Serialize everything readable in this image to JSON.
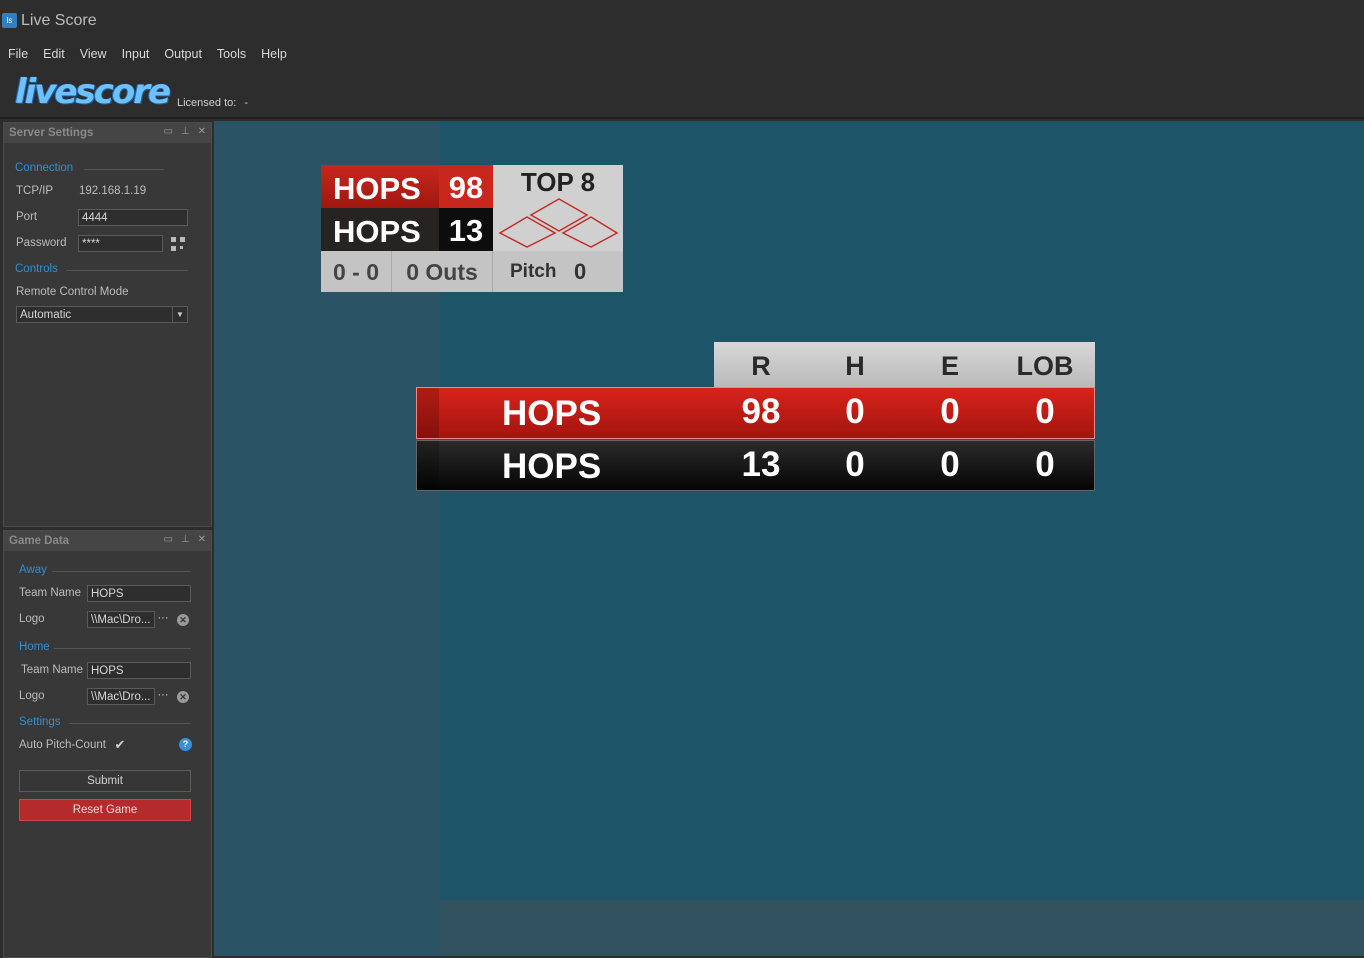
{
  "window": {
    "title": "Live Score",
    "icon": "live-score-app-icon"
  },
  "menu": [
    "File",
    "Edit",
    "View",
    "Input",
    "Output",
    "Tools",
    "Help"
  ],
  "header": {
    "logo_text": "livescore",
    "licensed_label": "Licensed to:",
    "licensed_value": "-"
  },
  "server_settings": {
    "title": "Server Settings",
    "connection_section": "Connection",
    "tcp_label": "TCP/IP",
    "tcp_value": "192.168.1.19",
    "port_label": "Port",
    "port_value": "4444",
    "password_label": "Password",
    "password_value": "****",
    "controls_section": "Controls",
    "remote_mode_label": "Remote Control Mode",
    "remote_mode_value": "Automatic"
  },
  "game_data": {
    "title": "Game Data",
    "away_section": "Away",
    "away_team_label": "Team Name",
    "away_team_value": "HOPS",
    "away_logo_label": "Logo",
    "away_logo_value": "\\\\Mac\\Dro...",
    "home_section": "Home",
    "home_team_label": "Team Name",
    "home_team_value": "HOPS",
    "home_logo_label": "Logo",
    "home_logo_value": "\\\\Mac\\Dro...",
    "settings_section": "Settings",
    "auto_pitch_label": "Auto Pitch-Count",
    "auto_pitch_checked": true,
    "browse_label": "···",
    "submit_label": "Submit",
    "reset_label": "Reset Game"
  },
  "scorebug": {
    "away_team": "HOPS",
    "away_score": "98",
    "home_team": "HOPS",
    "home_score": "13",
    "inning": "TOP 8",
    "count": "0 - 0",
    "outs": "0 Outs",
    "pitch_label": "Pitch",
    "pitch_value": "0",
    "bases_occupied": [
      false,
      false,
      false
    ]
  },
  "linescore": {
    "columns": [
      "R",
      "H",
      "E",
      "LOB"
    ],
    "rows": [
      {
        "team": "HOPS",
        "values": [
          "98",
          "0",
          "0",
          "0"
        ]
      },
      {
        "team": "HOPS",
        "values": [
          "13",
          "0",
          "0",
          "0"
        ]
      }
    ]
  },
  "colors": {
    "accent_blue": "#2f8fd6",
    "away_red": "#c8271d",
    "home_black": "#0d0d0d",
    "reset_red": "#b52a2a"
  }
}
